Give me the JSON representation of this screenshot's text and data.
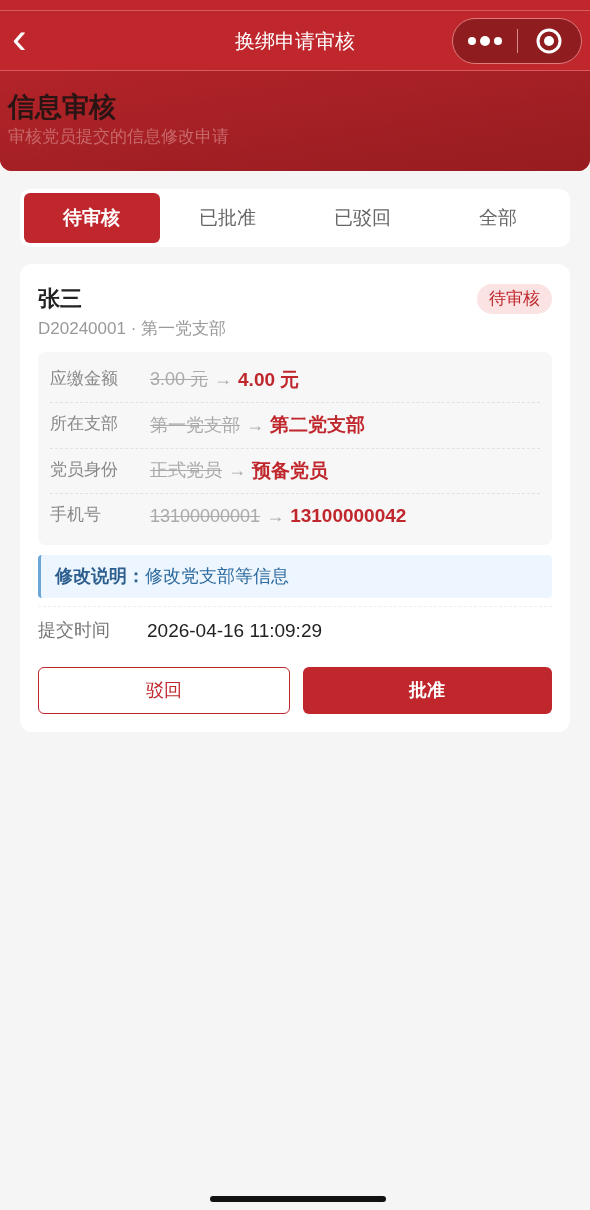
{
  "nav": {
    "back": "‹",
    "title": "换绑申请审核"
  },
  "header": {
    "title": "信息审核",
    "subtitle": "审核党员提交的信息修改申请"
  },
  "tabs": [
    {
      "label": "待审核",
      "selected": true
    },
    {
      "label": "已批准",
      "selected": false
    },
    {
      "label": "已驳回",
      "selected": false
    },
    {
      "label": "全部",
      "selected": false
    }
  ],
  "requests": [
    {
      "name": "张三",
      "status": "待审核",
      "meta": "D20240001 · 第一党支部",
      "changes": [
        {
          "label": "应缴金额",
          "old": "3.00 元",
          "arrow": "→",
          "new": "4.00 元"
        },
        {
          "label": "所在支部",
          "old": "第一党支部",
          "arrow": "→",
          "new": "第二党支部"
        },
        {
          "label": "党员身份",
          "old": "正式党员",
          "arrow": "→",
          "new": "预备党员"
        },
        {
          "label": "手机号",
          "old": "13100000001",
          "arrow": "→",
          "new": "13100000042"
        }
      ],
      "note_label": "修改说明：",
      "note": "修改党支部等信息",
      "time_label": "提交时间",
      "time": "2026-04-16 11:09:29",
      "buttons": [
        {
          "label": "驳回",
          "kind": "secondary"
        },
        {
          "label": "批准",
          "kind": "primary"
        }
      ]
    }
  ]
}
